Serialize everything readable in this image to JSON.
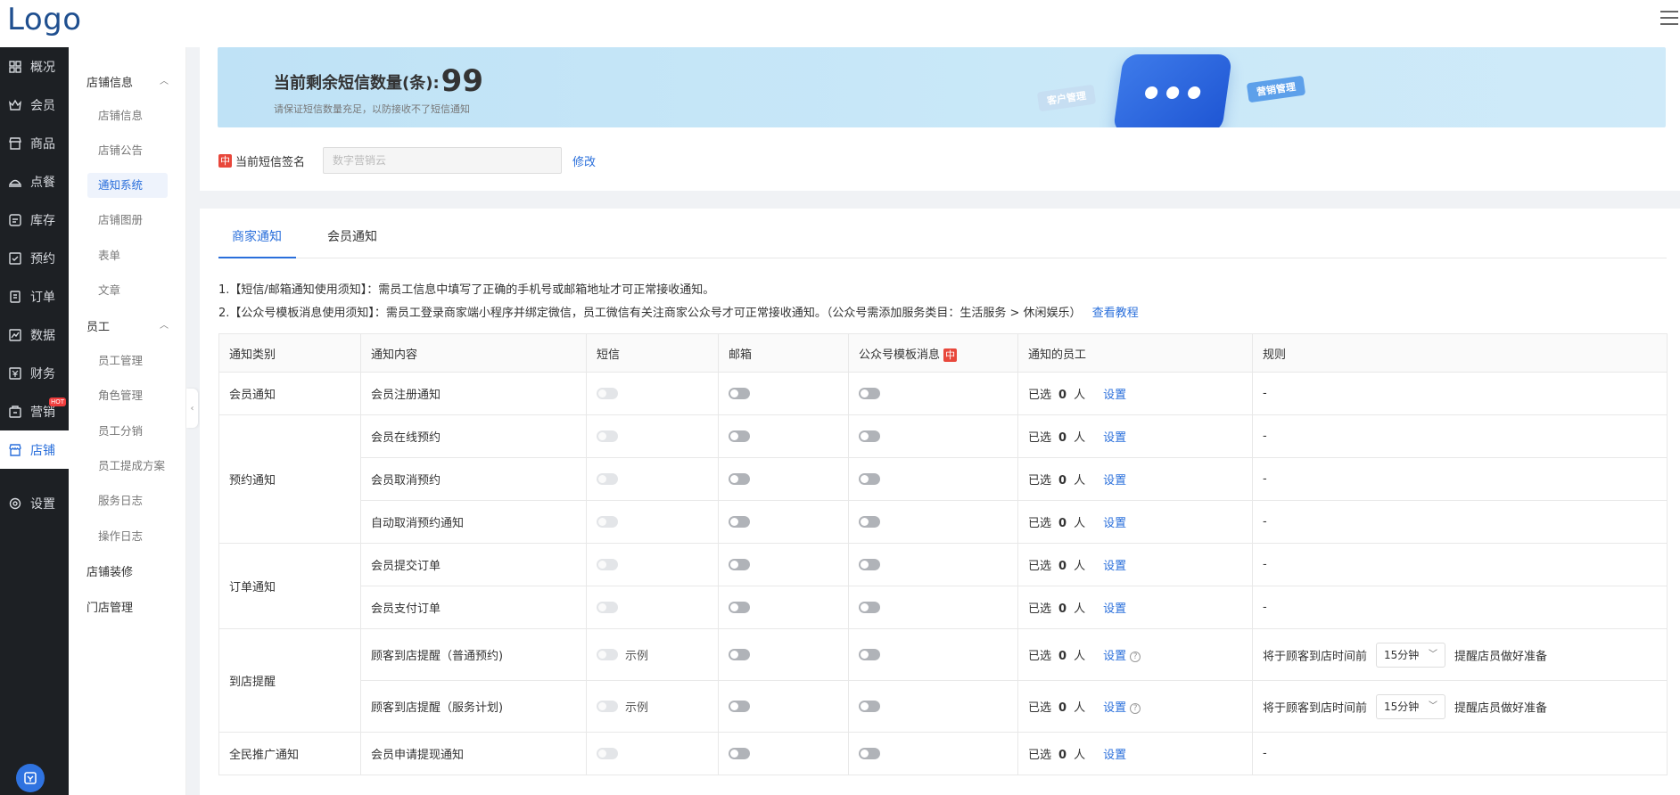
{
  "header": {
    "logo": "Logo"
  },
  "sidebar": {
    "items": [
      {
        "label": "概况",
        "icon": "dashboard-icon"
      },
      {
        "label": "会员",
        "icon": "crown-icon"
      },
      {
        "label": "商品",
        "icon": "store-icon"
      },
      {
        "label": "点餐",
        "icon": "dish-icon"
      },
      {
        "label": "库存",
        "icon": "inventory-icon"
      },
      {
        "label": "预约",
        "icon": "calendar-check-icon"
      },
      {
        "label": "订单",
        "icon": "order-icon"
      },
      {
        "label": "数据",
        "icon": "chart-icon"
      },
      {
        "label": "财务",
        "icon": "finance-icon"
      },
      {
        "label": "营销",
        "icon": "marketing-icon",
        "badge": "HOT"
      },
      {
        "label": "店铺",
        "icon": "shop-icon",
        "active": true
      },
      {
        "label": "设置",
        "icon": "gear-icon"
      }
    ]
  },
  "subnav": {
    "group_store": "店铺信息",
    "store_items": [
      "店铺信息",
      "店铺公告",
      "通知系统",
      "店铺图册",
      "表单",
      "文章"
    ],
    "group_staff": "员工",
    "staff_items": [
      "员工管理",
      "角色管理",
      "员工分销",
      "员工提成方案",
      "服务日志",
      "操作日志"
    ],
    "decor": "店铺装修",
    "outlet": "门店管理"
  },
  "banner": {
    "title": "当前剩余短信数量(条):",
    "count": "99",
    "subtitle": "请保证短信数量充足，以防接收不了短信通知",
    "tag_customer": "客户管理",
    "tag_marketing": "营销管理"
  },
  "signature": {
    "badge": "中",
    "label": "当前短信签名",
    "value": "数字营销云",
    "edit": "修改"
  },
  "tabs": [
    "商家通知",
    "会员通知"
  ],
  "notes": {
    "line1": "1.【短信/邮箱通知使用须知】：需员工信息中填写了正确的手机号或邮箱地址才可正常接收通知。",
    "line2": "2.【公众号模板消息使用须知】：需员工登录商家端小程序并绑定微信，员工微信有关注商家公众号才可正常接收通知。（公众号需添加服务类目：生活服务 > 休闲娱乐）",
    "tutorial": "查看教程"
  },
  "table": {
    "headers": [
      "通知类别",
      "通知内容",
      "短信",
      "邮箱",
      "公众号模板消息",
      "通知的员工",
      "规则"
    ],
    "wechat_badge": "中",
    "selected_prefix": "已选",
    "selected_suffix": "人",
    "set_label": "设置",
    "example_label": "示例",
    "rule_prefix": "将于顾客到店时间前",
    "rule_suffix": "提醒店员做好准备",
    "rule_option": "15分钟",
    "dash": "-",
    "categories": {
      "member": "会员通知",
      "booking": "预约通知",
      "order": "订单通知",
      "arrival": "到店提醒",
      "promo": "全民推广通知"
    },
    "rows": [
      {
        "content": "会员注册通知",
        "count": "0"
      },
      {
        "content": "会员在线预约",
        "count": "0"
      },
      {
        "content": "会员取消预约",
        "count": "0"
      },
      {
        "content": "自动取消预约通知",
        "count": "0"
      },
      {
        "content": "会员提交订单",
        "count": "0"
      },
      {
        "content": "会员支付订单",
        "count": "0"
      },
      {
        "content": "顾客到店提醒（普通预约)",
        "count": "0"
      },
      {
        "content": "顾客到店提醒（服务计划)",
        "count": "0"
      },
      {
        "content": "会员申请提现通知",
        "count": "0"
      }
    ]
  }
}
